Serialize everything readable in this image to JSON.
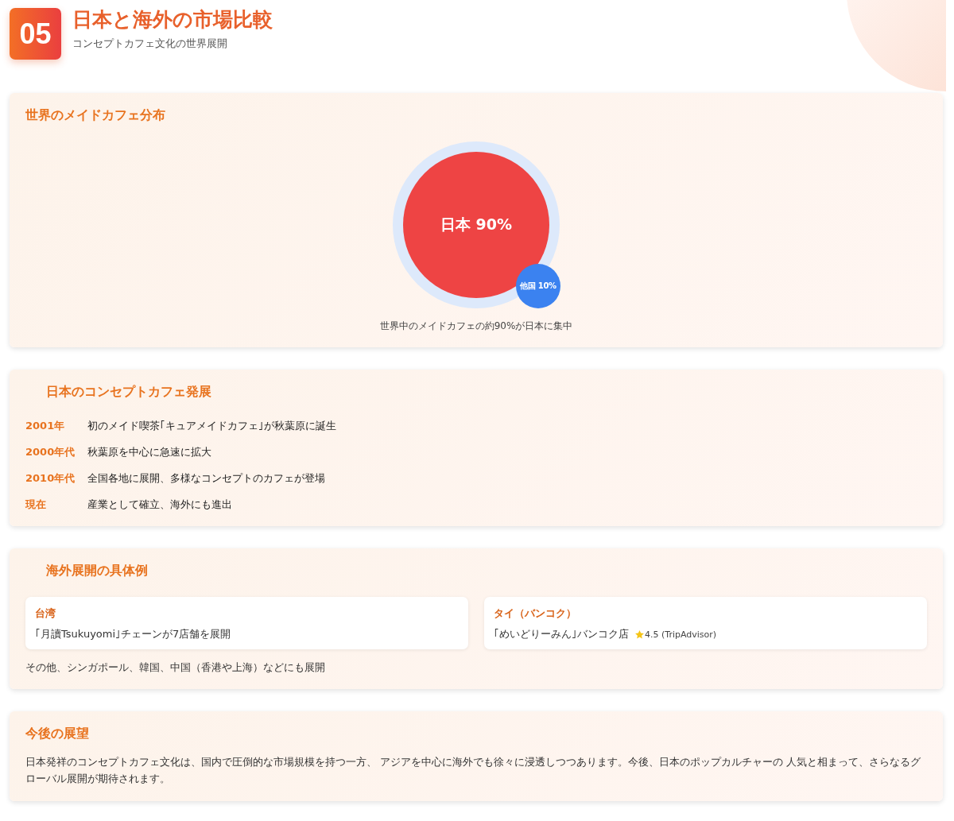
{
  "header": {
    "number": "05",
    "title": "日本と海外の市場比較",
    "subtitle": "コンセプトカフェ文化の世界展開"
  },
  "distribution": {
    "heading": "世界のメイドカフェ分布",
    "major_label": "日本 90%",
    "minor_label": "他国 10%",
    "caption": "世界中のメイドカフェの約90%が日本に集中"
  },
  "timeline": {
    "heading": "日本のコンセプトカフェ発展",
    "entries": [
      {
        "period": "2001年",
        "text": "初のメイド喫茶｢キュアメイドカフェ｣が秋葉原に誕生"
      },
      {
        "period": "2000年代",
        "text": "秋葉原を中心に急速に拡大"
      },
      {
        "period": "2010年代",
        "text": "全国各地に展開、多様なコンセプトのカフェが登場"
      },
      {
        "period": "現在",
        "text": "産業として確立、海外にも進出"
      }
    ]
  },
  "examples": {
    "heading": "海外展開の具体例",
    "cards": [
      {
        "region": "台湾",
        "text": "｢月讀Tsukuyomi｣チェーンが7店舗を展開"
      },
      {
        "region": "タイ（バンコク）",
        "text": "｢めいどりーみん｣バンコク店",
        "rating": "4.5 (TripAdvisor)"
      }
    ],
    "note": "その他、シンガポール、韓国、中国（香港や上海）などにも展開"
  },
  "outlook": {
    "heading": "今後の展望",
    "text": "日本発祥のコンセプトカフェ文化は、国内で圧倒的な市場規模を持つ一方、 アジアを中心に海外でも徐々に浸透しつつあります。今後、日本のポップカルチャーの 人気と相まって、さらなるグローバル展開が期待されます。"
  }
}
